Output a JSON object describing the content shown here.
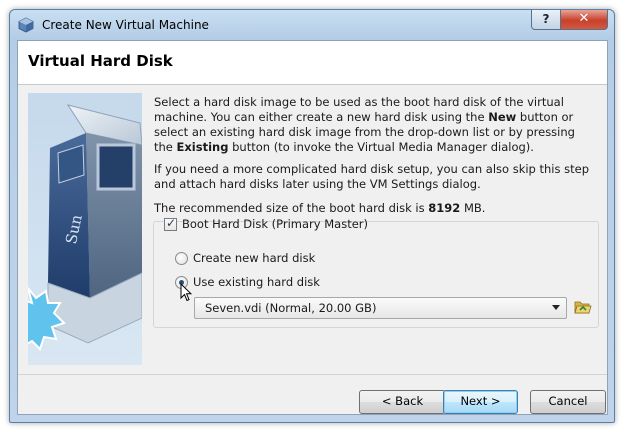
{
  "window": {
    "title": "Create New Virtual Machine",
    "help_label": "?",
    "close_label": "✕"
  },
  "page": {
    "title": "Virtual Hard Disk"
  },
  "description": {
    "p1_a": "Select a hard disk image to be used as the boot hard disk of the virtual machine. You can either create a new hard disk using the ",
    "p1_b": "New",
    "p1_c": " button or select an existing hard disk image from the drop-down list or by pressing the ",
    "p1_d": "Existing",
    "p1_e": " button (to invoke the Virtual Media Manager dialog).",
    "p2": "If you need a more complicated hard disk setup, you can also skip this step and attach hard disks later using the VM Settings dialog.",
    "p3_a": "The recommended size of the boot hard disk is ",
    "p3_b": "8192",
    "p3_c": " MB."
  },
  "boot_disk": {
    "checkbox_label": "Boot Hard Disk (Primary Master)",
    "checked": true,
    "create_new_label": "Create new hard disk",
    "use_existing_label": "Use existing hard disk",
    "selected_option": "use_existing",
    "disk_select_value": "Seven.vdi (Normal, 20.00 GB)",
    "folder_icon": "folder-open-icon"
  },
  "buttons": {
    "back": "< Back",
    "next": "Next >",
    "cancel": "Cancel"
  },
  "colors": {
    "title_bar": "#bfd4ea",
    "close_button": "#c7412c",
    "default_button_border": "#3c7fb1"
  }
}
